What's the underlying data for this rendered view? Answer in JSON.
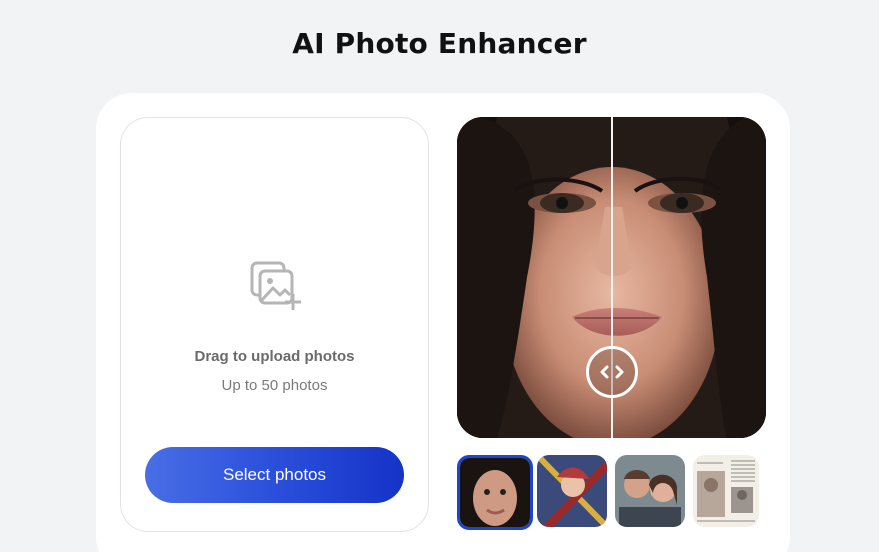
{
  "header": {
    "title": "AI Photo Enhancer"
  },
  "upload": {
    "icon": "image-add-icon",
    "title": "Drag to upload photos",
    "subtitle": "Up to 50 photos",
    "button_label": "Select photos"
  },
  "preview": {
    "handle_icon": "chevron-left-right-icon",
    "comparison_split": 0.5
  },
  "thumbnails": [
    {
      "name": "sample-portrait-woman",
      "active": true
    },
    {
      "name": "sample-anime-art",
      "active": false
    },
    {
      "name": "sample-couple-selfie",
      "active": false
    },
    {
      "name": "sample-old-newspaper",
      "active": false
    }
  ],
  "colors": {
    "accent": "#2d52dc",
    "background": "#f2f3f5"
  }
}
